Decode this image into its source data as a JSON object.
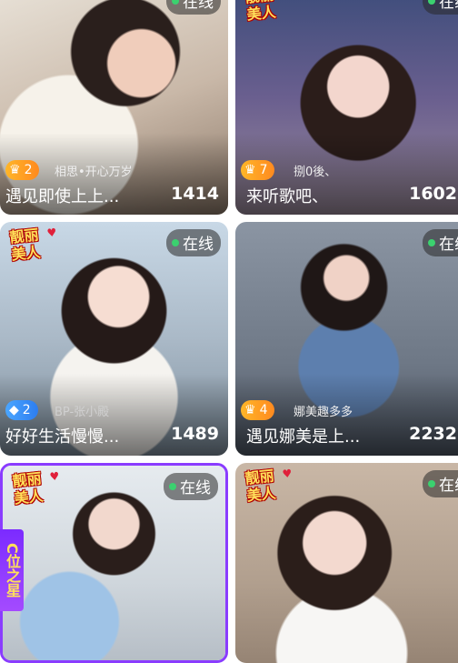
{
  "online_label": "在线",
  "badge_text": "靓丽美人",
  "cards": [
    {
      "title": "遇见即使上上...",
      "count": "1414",
      "level": "2",
      "level_type": "gold",
      "creator": "相思•开心万岁",
      "online_visible": true
    },
    {
      "title": "来听歌吧、",
      "count": "1602",
      "level": "7",
      "level_type": "gold",
      "creator": "捌0後、",
      "online_visible": true
    },
    {
      "title": "好好生活慢慢...",
      "count": "1489",
      "level": "2",
      "level_type": "blue",
      "creator": "BP-张小殿",
      "online_visible": true
    },
    {
      "title": "遇见娜美是上...",
      "count": "2232",
      "level": "4",
      "level_type": "gold",
      "creator": "娜美趣多多",
      "online_visible": true
    },
    {
      "title": "",
      "count": "",
      "level": "",
      "level_type": "",
      "creator": "",
      "online_visible": true,
      "side_label": "C位之星"
    },
    {
      "title": "",
      "count": "",
      "level": "",
      "level_type": "",
      "creator": "",
      "online_visible": true
    }
  ]
}
